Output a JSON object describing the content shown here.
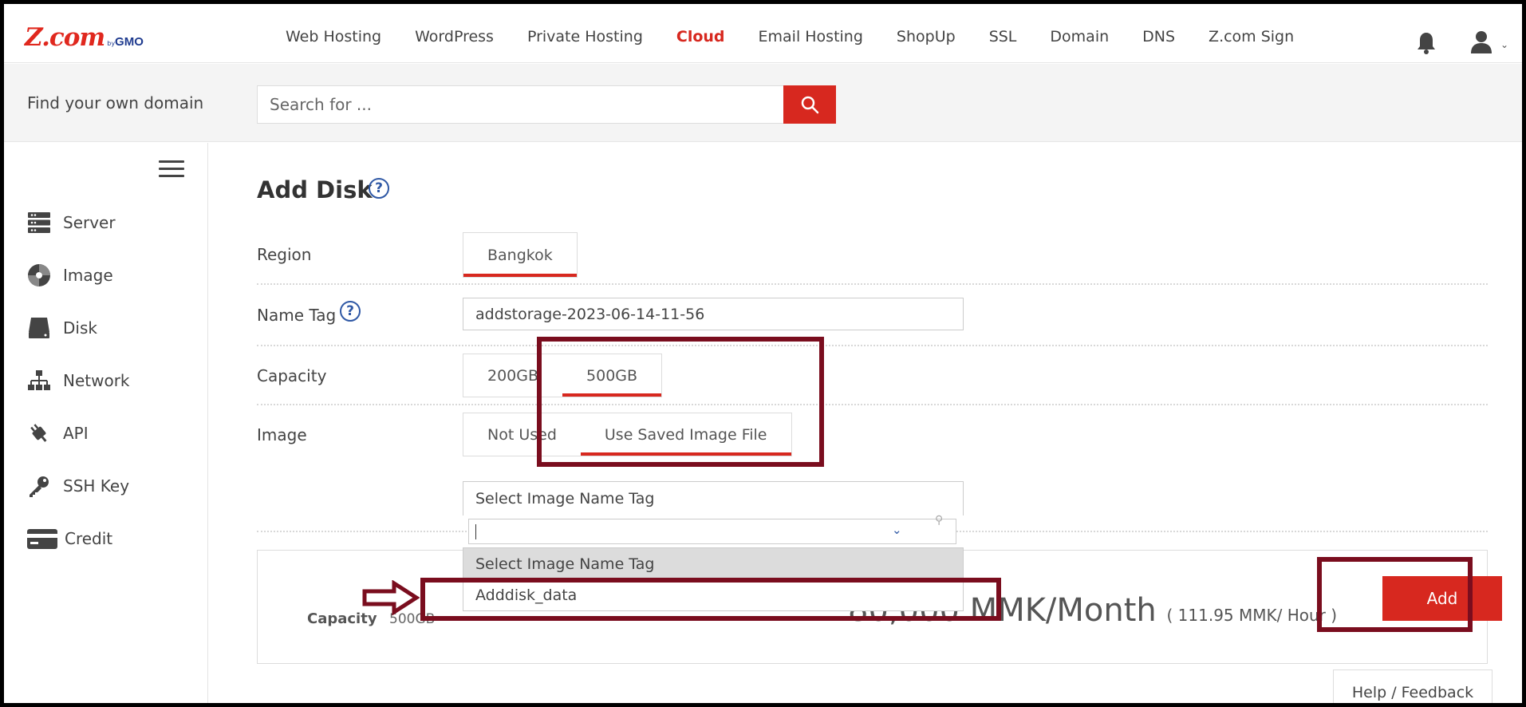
{
  "header": {
    "logo_brand": "Z.com",
    "logo_by": "by",
    "logo_gmo": "GMO",
    "nav": [
      {
        "label": "Web Hosting",
        "active": false
      },
      {
        "label": "WordPress",
        "active": false
      },
      {
        "label": "Private Hosting",
        "active": false
      },
      {
        "label": "Cloud",
        "active": true
      },
      {
        "label": "Email Hosting",
        "active": false
      },
      {
        "label": "ShopUp",
        "active": false
      },
      {
        "label": "SSL",
        "active": false
      },
      {
        "label": "Domain",
        "active": false
      },
      {
        "label": "DNS",
        "active": false
      },
      {
        "label": "Z.com Sign",
        "active": false
      }
    ],
    "icons": [
      "bell-icon",
      "user-icon",
      "chevron-down-icon"
    ]
  },
  "domain_search": {
    "label": "Find your own domain",
    "placeholder": "Search for ...",
    "button_icon": "search-icon"
  },
  "sidebar": {
    "menu_icon": "hamburger-icon",
    "items": [
      {
        "label": "Server",
        "icon": "server-icon"
      },
      {
        "label": "Image",
        "icon": "image-disc-icon"
      },
      {
        "label": "Disk",
        "icon": "disk-icon"
      },
      {
        "label": "Network",
        "icon": "network-icon"
      },
      {
        "label": "API",
        "icon": "api-icon"
      },
      {
        "label": "SSH Key",
        "icon": "key-icon"
      },
      {
        "label": "Credit",
        "icon": "credit-card-icon"
      }
    ]
  },
  "form": {
    "title": "Add Disk",
    "help_glyph": "?",
    "region": {
      "label": "Region",
      "options": [
        "Bangkok"
      ],
      "selected": "Bangkok"
    },
    "name_tag": {
      "label": "Name Tag",
      "value": "addstorage-2023-06-14-11-56"
    },
    "capacity": {
      "label": "Capacity",
      "options": [
        "200GB",
        "500GB"
      ],
      "selected": "500GB"
    },
    "image": {
      "label": "Image",
      "options": [
        "Not Used",
        "Use Saved Image File"
      ],
      "selected": "Use Saved Image File",
      "select_value": "Select Image Name Tag",
      "dropdown_options": [
        "Select Image Name Tag",
        "Adddisk_data"
      ],
      "highlighted_option": "Select Image Name Tag"
    }
  },
  "summary": {
    "capacity_label": "Capacity",
    "capacity_value": "500GB",
    "price": "80,000 MMK/Month",
    "price_hour": "( 111.95 MMK/ Hour )",
    "add_label": "Add"
  },
  "help_feedback": "Help / Feedback",
  "colors": {
    "accent": "#d7281f",
    "annotation": "#7a0d1e",
    "link_blue": "#2f58a5"
  }
}
